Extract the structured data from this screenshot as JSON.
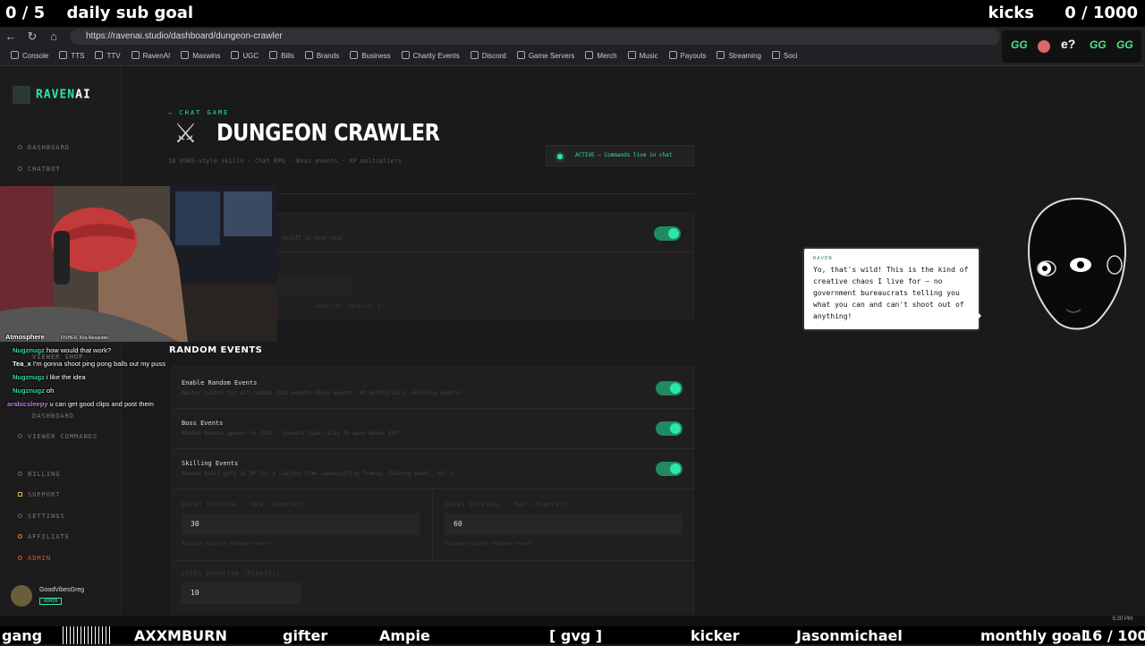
{
  "overlay": {
    "sub_goal_count": "0 / 5",
    "sub_goal_label": "daily sub goal",
    "kicks_label": "kicks",
    "kicks_count": "0 / 1000",
    "ticker": [
      "gang",
      "AXXMBURN",
      "gifter",
      "Ampie",
      "[ gvg ]",
      "kicker",
      "Jasonmichael"
    ],
    "monthly_goal_label": "monthly goal",
    "monthly_goal_count": "16 / 100"
  },
  "browser": {
    "url": "https://ravenai.studio/dashboard/dungeon-crawler",
    "bookmarks": [
      "Console",
      "TTS",
      "TTV",
      "RavenAI",
      "Maxwins",
      "UGC",
      "Bills",
      "Brands",
      "Business",
      "Charity Events",
      "Discord",
      "Game Servers",
      "Merch",
      "Music",
      "Payouts",
      "Streaming",
      "Soci"
    ]
  },
  "emotes": [
    "GG",
    "e?",
    "GG",
    "GG"
  ],
  "sidebar": {
    "logo_main": "RAVEN",
    "logo_accent": "AI",
    "items": {
      "dashboard": "DASHBOARD",
      "chatbot": "CHATBOT",
      "viewer_shop": "VIEWER SHOP",
      "viewer_dashboard": "DASHBOARD",
      "viewer_commands": "VIEWER COMMANDS",
      "billing": "BILLING",
      "support": "SUPPORT",
      "settings": "SETTINGS",
      "affiliate": "AFFILIATE",
      "admin": "ADMIN"
    },
    "user": {
      "name": "GoodVibesGreg",
      "badge": "ADMIN"
    }
  },
  "page": {
    "eyebrow": "— CHAT GAME",
    "title": "DUNGEON CRAWLER",
    "subtitle": "16 OSRS-style skills · Chat RPG · Boss events · XP multipliers",
    "status": "ACTIVE — Commands live in chat",
    "game_row_desc": "on/off in your chat",
    "xp_row_desc": "each !XP. Default: 1"
  },
  "random_events": {
    "heading": "RANDOM EVENTS",
    "rows": [
      {
        "label": "Enable Random Events",
        "desc": "Master switch for all random chat events (boss events, XP multipliers, skilling events)",
        "on": true
      },
      {
        "label": "Boss Events",
        "desc": "Random bosses appear in chat — viewers type !slay to earn bonus EXP",
        "on": true
      },
      {
        "label": "Skilling Events",
        "desc": "Random skill gets 2x XP for a limited time (woodcutting frenzy, fishing event, etc.)",
        "on": true
      }
    ],
    "interval_min": {
      "label": "EVENT INTERVAL — MIN (MINUTES)",
      "value": "30",
      "hint": "Minimum minutes between events"
    },
    "interval_max": {
      "label": "EVENT INTERVAL — MAX (MINUTES)",
      "value": "60",
      "hint": "Maximum minutes between events"
    },
    "duration": {
      "label": "EVENT DURATION (MINUTES)",
      "value": "10"
    }
  },
  "raven": {
    "speaker": "RAVEN",
    "message": "Yo, that's wild! This is the kind of creative chaos I live for — no government bureaucrats telling you what you can and can't shoot out of anything!"
  },
  "chat": {
    "header": "Atmosphere",
    "header_meta": "FISHER, Kita Alexander",
    "messages": [
      {
        "user": "Nugznugz",
        "text": "how would that work?"
      },
      {
        "user": "Tea_x",
        "text": "I'm gonna shoot ping pong balls out my puss"
      },
      {
        "user": "Nugznugz",
        "text": "i like the idea"
      },
      {
        "user": "Nugznugz",
        "text": "oh"
      },
      {
        "user": "arabicsleepy",
        "text": "u can get good clips and post them"
      }
    ]
  },
  "taskbar": {
    "time": "5:20 PM"
  },
  "colors": {
    "accent": "#2ee6a6",
    "admin": "#e0503a",
    "background": "#1a1a1a"
  }
}
